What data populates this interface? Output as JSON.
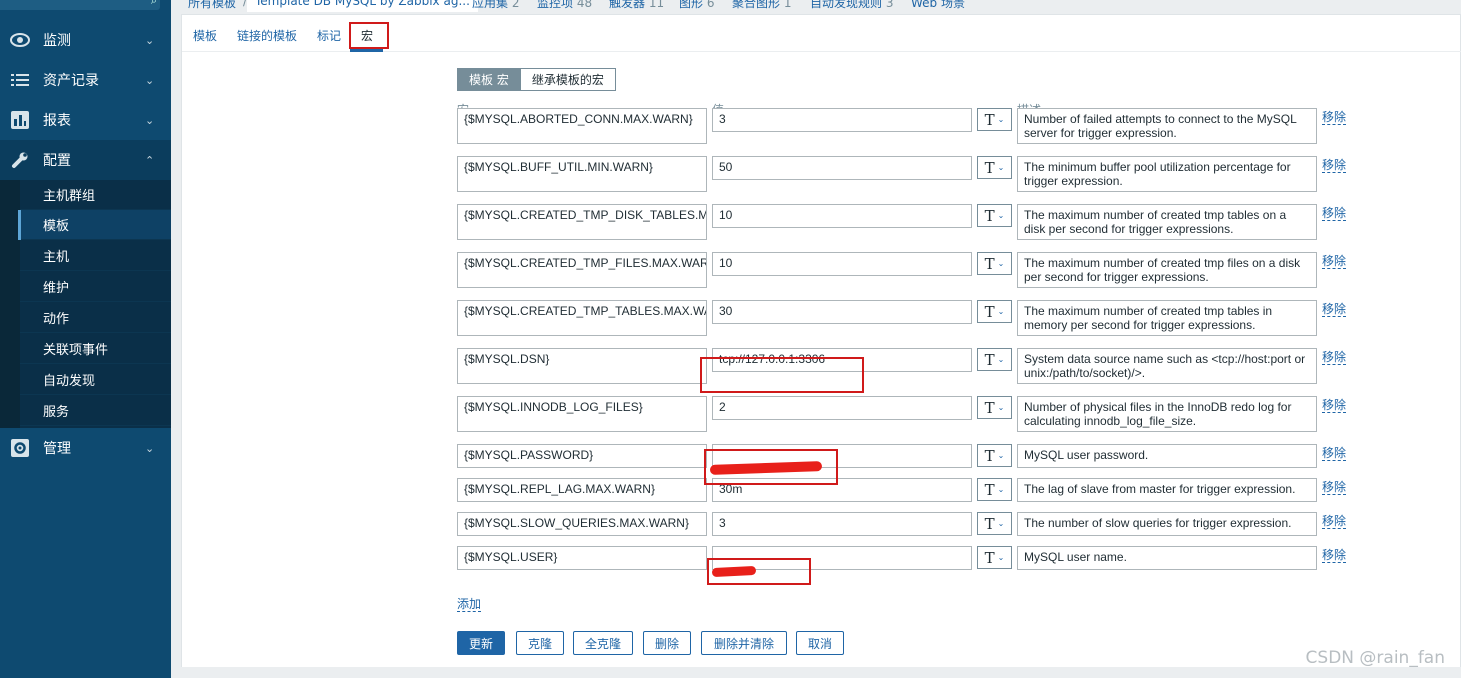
{
  "sidebar": {
    "menus": [
      {
        "label": "监测",
        "icon": "eye-icon"
      },
      {
        "label": "资产记录",
        "icon": "list-icon"
      },
      {
        "label": "报表",
        "icon": "bar-chart-icon"
      },
      {
        "label": "配置",
        "icon": "wrench-icon"
      },
      {
        "label": "管理",
        "icon": "gear-icon"
      }
    ],
    "submenu": [
      "主机群组",
      "模板",
      "主机",
      "维护",
      "动作",
      "关联项事件",
      "自动发现",
      "服务"
    ],
    "selected_submenu": "模板"
  },
  "breadcrumb": {
    "all_templates": "所有模板",
    "separator": "/",
    "template": "Template DB MySQL by Zabbix ag...",
    "items": [
      {
        "label": "应用集",
        "count": "2"
      },
      {
        "label": "监控项",
        "count": "48"
      },
      {
        "label": "触发器",
        "count": "11"
      },
      {
        "label": "图形",
        "count": "6"
      },
      {
        "label": "聚合图形",
        "count": "1"
      },
      {
        "label": "自动发现规则",
        "count": "3"
      },
      {
        "label": "Web 场景",
        "count": ""
      }
    ]
  },
  "tabs": [
    "模板",
    "链接的模板",
    "标记",
    "宏"
  ],
  "active_tab": "宏",
  "toggle": {
    "on": "模板 宏",
    "off": "继承模板的宏"
  },
  "columns": {
    "macro": "宏",
    "value": "值",
    "description": "描述"
  },
  "type_button": {
    "glyph": "T",
    "arrow": "⌄"
  },
  "remove_label": "移除",
  "macros": [
    {
      "macro": "{$MYSQL.ABORTED_CONN.MAX.WARN}",
      "value": "3",
      "description": "Number of failed attempts to connect to the MySQL server for trigger expression."
    },
    {
      "macro": "{$MYSQL.BUFF_UTIL.MIN.WARN}",
      "value": "50",
      "description": "The minimum buffer pool utilization percentage for trigger expression."
    },
    {
      "macro": "{$MYSQL.CREATED_TMP_DISK_TABLES.MAX.WARN}",
      "value": "10",
      "description": "The maximum number of created tmp tables on a disk per second for trigger expressions."
    },
    {
      "macro": "{$MYSQL.CREATED_TMP_FILES.MAX.WARN}",
      "value": "10",
      "description": "The maximum number of created tmp files on a disk per second for trigger expressions."
    },
    {
      "macro": "{$MYSQL.CREATED_TMP_TABLES.MAX.WARN}",
      "value": "30",
      "description": "The maximum number of created tmp tables in memory per second for trigger expressions."
    },
    {
      "macro": "{$MYSQL.DSN}",
      "value": "tcp://127.0.0.1:3306",
      "description": "System data source name such as <tcp://host:port or unix:/path/to/socket)/>."
    },
    {
      "macro": "{$MYSQL.INNODB_LOG_FILES}",
      "value": "2",
      "description": "Number of physical files in the InnoDB redo log for calculating innodb_log_file_size."
    },
    {
      "macro": "{$MYSQL.PASSWORD}",
      "value": "",
      "description": "MySQL user password."
    },
    {
      "macro": "{$MYSQL.REPL_LAG.MAX.WARN}",
      "value": "30m",
      "description": "The lag of slave from master for trigger expression."
    },
    {
      "macro": "{$MYSQL.SLOW_QUERIES.MAX.WARN}",
      "value": "3",
      "description": "The number of slow queries for trigger expression."
    },
    {
      "macro": "{$MYSQL.USER}",
      "value": "",
      "description": "MySQL user name."
    }
  ],
  "add_label": "添加",
  "buttons": [
    "更新",
    "克隆",
    "全克隆",
    "删除",
    "删除并清除",
    "取消"
  ],
  "watermark": "CSDN @rain_fan",
  "colors": {
    "sidebar": "#0e4a70",
    "link": "#1f65a6",
    "highlight": "#d01a1a"
  }
}
